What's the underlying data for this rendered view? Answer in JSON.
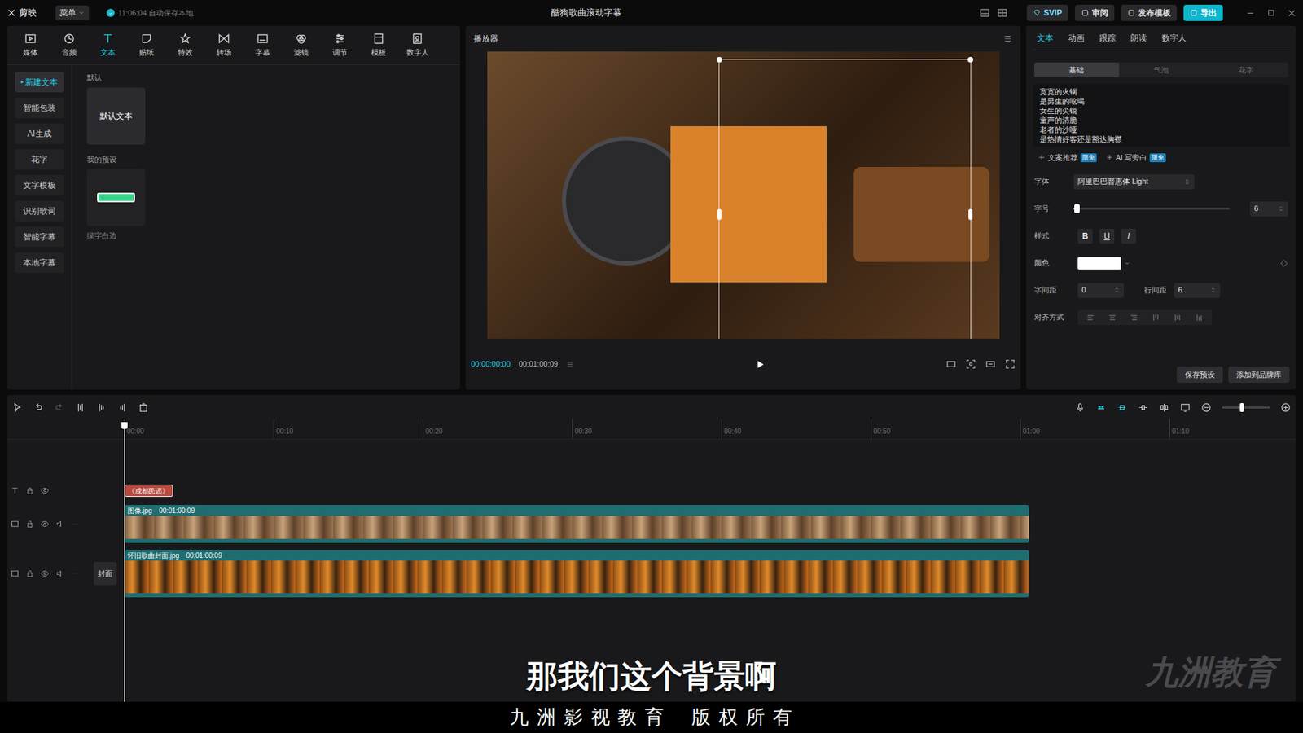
{
  "app": {
    "logo": "剪映",
    "menu": "菜单",
    "autosave": "11:06:04 自动保存本地",
    "title": "酷狗歌曲滚动字幕",
    "actions": [
      {
        "label": "SVIP",
        "kind": "vip"
      },
      {
        "label": "审阅",
        "kind": "plain"
      },
      {
        "label": "发布模板",
        "kind": "plain"
      },
      {
        "label": "导出",
        "kind": "primary"
      }
    ]
  },
  "toolbar": [
    {
      "label": "媒体",
      "selected": false
    },
    {
      "label": "音频",
      "selected": false
    },
    {
      "label": "文本",
      "selected": true
    },
    {
      "label": "贴纸",
      "selected": false
    },
    {
      "label": "特效",
      "selected": false
    },
    {
      "label": "转场",
      "selected": false
    },
    {
      "label": "字幕",
      "selected": false
    },
    {
      "label": "滤镜",
      "selected": false
    },
    {
      "label": "调节",
      "selected": false
    },
    {
      "label": "模板",
      "selected": false
    },
    {
      "label": "数字人",
      "selected": false
    }
  ],
  "left_menu": [
    {
      "label": "新建文本",
      "selected": true
    },
    {
      "label": "智能包装",
      "selected": false
    },
    {
      "label": "AI生成",
      "selected": false
    },
    {
      "label": "花字",
      "selected": false
    },
    {
      "label": "文字模板",
      "selected": false
    },
    {
      "label": "识别歌词",
      "selected": false
    },
    {
      "label": "智能字幕",
      "selected": false
    },
    {
      "label": "本地字幕",
      "selected": false
    }
  ],
  "library": {
    "default_heading": "默认",
    "default_card": "默认文本",
    "preset_heading": "我的预设",
    "preset_label": "绿字白边"
  },
  "player": {
    "title": "播放器",
    "current": "00:00:00:00",
    "duration": "00:01:00:09"
  },
  "inspector": {
    "tabs": [
      {
        "label": "文本",
        "selected": true
      },
      {
        "label": "动画",
        "selected": false
      },
      {
        "label": "跟踪",
        "selected": false
      },
      {
        "label": "朗读",
        "selected": false
      },
      {
        "label": "数字人",
        "selected": false
      }
    ],
    "subtabs": [
      {
        "label": "基础",
        "selected": true
      },
      {
        "label": "气泡",
        "selected": false
      },
      {
        "label": "花字",
        "selected": false
      }
    ],
    "text_lines": [
      "宽宽的火锅",
      "是男生的吆喝",
      "女生的尖锐",
      "童声的清脆",
      "老者的沙哑",
      "是热情好客还是豁达胸襟"
    ],
    "ai_buttons": [
      {
        "label": "文案推荐",
        "badge": "限免"
      },
      {
        "label": "AI 写旁白",
        "badge": "限免"
      }
    ],
    "font_label": "字体",
    "font": "阿里巴巴普惠体 Light",
    "size_label": "字号",
    "size": {
      "level": 0.02,
      "value": "6"
    },
    "style_label": "样式",
    "styles": [
      {
        "label": "B",
        "selected": false
      },
      {
        "label": "U",
        "selected": false
      },
      {
        "label": "I",
        "selected": false
      }
    ],
    "color_label": "颜色",
    "color": "#ffffff",
    "spacing_label": "字间距",
    "spacing": "0",
    "line_label": "行间距",
    "line": "6",
    "align_label": "对齐方式",
    "buttons": [
      "保存预设",
      "添加到品牌库"
    ]
  },
  "timeline": {
    "ruler": [
      "00:00",
      "00:10",
      "00:20",
      "00:30",
      "00:40",
      "00:50",
      "01:00",
      "01:10"
    ],
    "tracks": [
      {
        "kind": "text",
        "name": "《成都民谣》",
        "duration": "",
        "cover": ""
      },
      {
        "kind": "video",
        "name": "图像.jpg",
        "duration": "00:01:00:09",
        "cover": ""
      },
      {
        "kind": "cover",
        "name": "怀旧歌曲封面.jpg",
        "duration": "00:01:00:09",
        "cover": "封面"
      }
    ]
  },
  "overlay": {
    "subtitle": "那我们这个背景啊",
    "watermark": "九洲教育",
    "copyright": "九 洲 影 视 教 育    版 权 所 有"
  }
}
